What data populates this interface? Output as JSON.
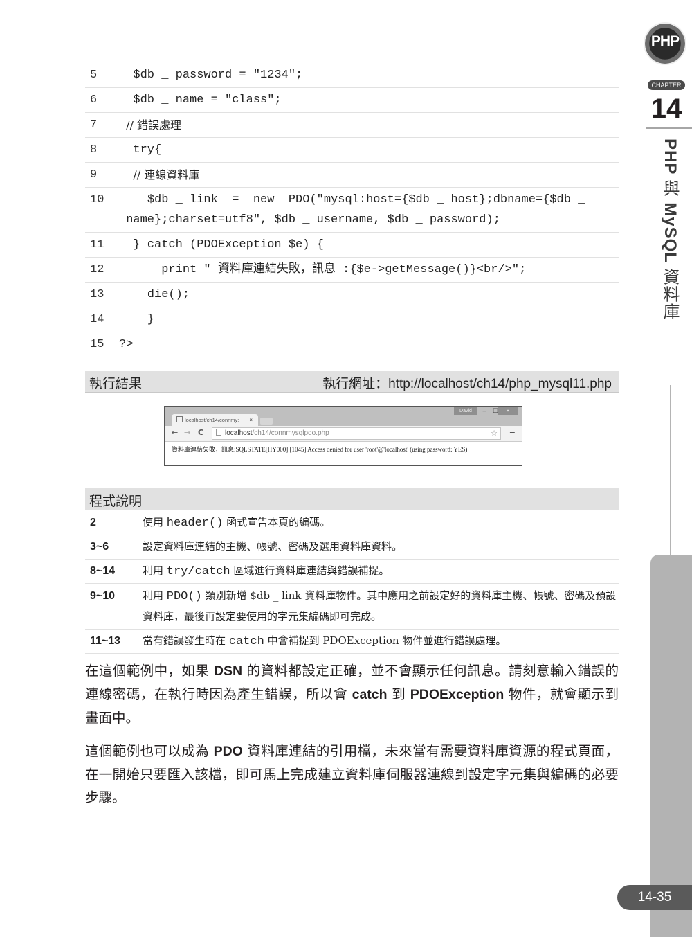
{
  "code_listing": {
    "lines": [
      {
        "no": "5",
        "text": "  $db _ password = \"1234\";"
      },
      {
        "no": "6",
        "text": "  $db _ name = \"class\";"
      },
      {
        "no": "7",
        "text": "  // 錯誤處理"
      },
      {
        "no": "8",
        "text": "  try{"
      },
      {
        "no": "9",
        "text": "    // 連線資料庫"
      },
      {
        "no": "10",
        "text": "    $db _ link  =  new  PDO(\"mysql:host={$db _ host};dbname={$db _\n name};charset=utf8\", $db _ username, $db _ password);"
      },
      {
        "no": "11",
        "text": "  } catch (PDOException $e) {"
      },
      {
        "no": "12",
        "text": "      print \" 資料庫連結失敗，訊息 :{$e->getMessage()}<br/>\";"
      },
      {
        "no": "13",
        "text": "    die();"
      },
      {
        "no": "14",
        "text": "    }"
      },
      {
        "no": "15",
        "text": "?>"
      }
    ]
  },
  "result_section": {
    "title": "執行結果",
    "url_label": "執行網址：",
    "url": "http://localhost/ch14/php_mysql11.php"
  },
  "browser_screenshot": {
    "tab_title": "localhost/ch14/connmy:",
    "tab_close": "×",
    "user_badge": "David",
    "minimize": "–",
    "maximize": "☐",
    "close": "×",
    "back": "←",
    "forward": "→",
    "reload": "C",
    "address_host": "localhost",
    "address_path": "/ch14/connmysqlpdo.php",
    "star": "☆",
    "menu": "≡",
    "content_prefix": "資料庫連結失敗，訊息",
    "content_message": ":SQLSTATE[HY000] [1045] Access denied for user 'root'@'localhost' (using password: YES)"
  },
  "explanation_section": {
    "title": "程式說明",
    "rows": [
      {
        "lines": "2",
        "desc_pre": "使用 ",
        "desc_code": "header()",
        "desc_post": " 函式宣告本頁的編碼。"
      },
      {
        "lines": "3~6",
        "desc_pre": "設定資料庫連結的主機、帳號、密碼及選用資料庫資料。",
        "desc_code": "",
        "desc_post": ""
      },
      {
        "lines": "8~14",
        "desc_pre": "利用 ",
        "desc_code": "try/catch",
        "desc_post": " 區域進行資料庫連結與錯誤補捉。"
      },
      {
        "lines": "9~10",
        "desc_pre": "利用 ",
        "desc_code": "PDO()",
        "desc_post": " 類別新增 $db _ link 資料庫物件。其中應用之前設定好的資料庫主機、帳號、密碼及預設資料庫，最後再設定要使用的字元集編碼即可完成。"
      },
      {
        "lines": "11~13",
        "desc_pre": "當有錯誤發生時在 ",
        "desc_code": "catch",
        "desc_post": " 中會補捉到 PDOException 物件並進行錯誤處理。"
      }
    ]
  },
  "paragraphs": [
    {
      "p1": "在這個範例中，如果 ",
      "b1": "DSN",
      "p2": " 的資料都設定正確，並不會顯示任何訊息。請刻意輸入錯誤的連線密碼，在執行時因為產生錯誤，所以會 ",
      "b2": "catch",
      "p3": " 到 ",
      "b3": "PDOException",
      "p4": " 物件，就會顯示到畫面中。"
    },
    {
      "p1": "這個範例也可以成為 ",
      "b1": "PDO",
      "p2": " 資料庫連結的引用檔，未來當有需要資料庫資源的程式頁面，在一開始只要匯入該檔，即可馬上完成建立資料庫伺服器連線到設定字元集與編碼的必要步驟。"
    }
  ],
  "margin": {
    "logo_text": "PHP",
    "chapter_label": "CHAPTER",
    "chapter_number": "14",
    "chapter_title_a": "PHP ",
    "chapter_title_b": "與",
    "chapter_title_c": " MySQL ",
    "chapter_title_d": "資料庫"
  },
  "page_number": "14-35"
}
